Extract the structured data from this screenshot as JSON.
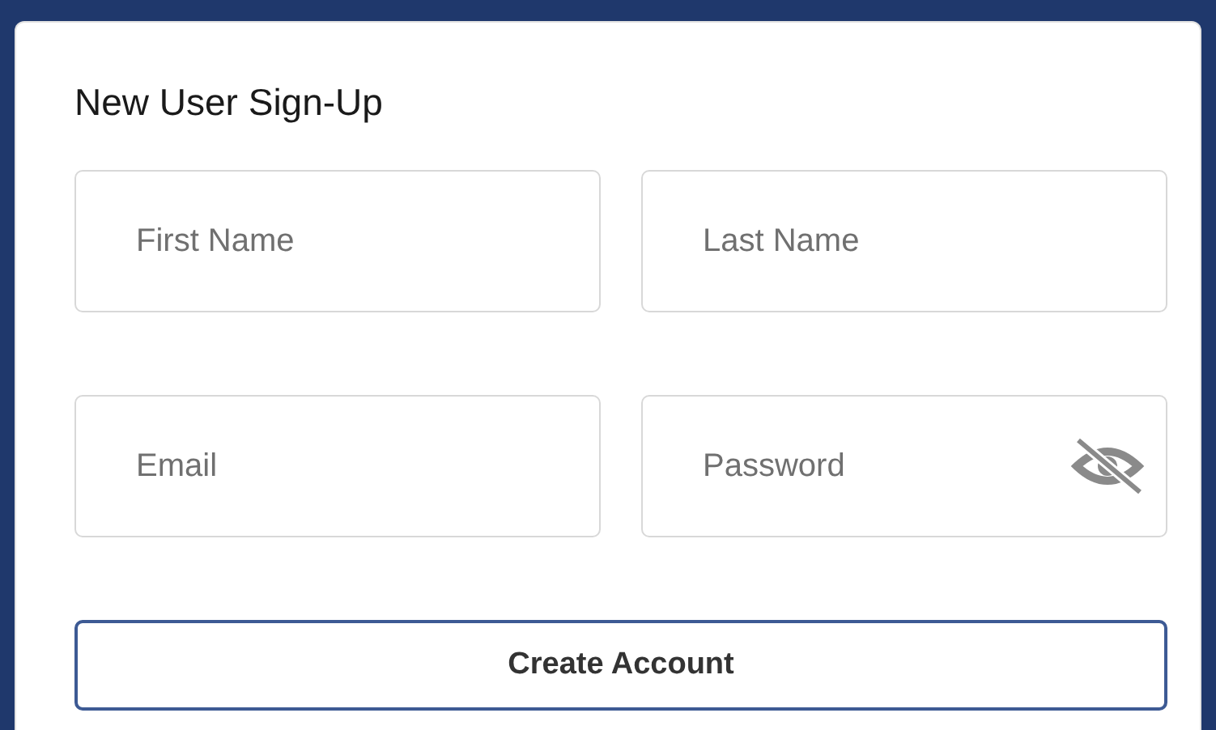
{
  "form": {
    "title": "New User Sign-Up",
    "fields": [
      {
        "placeholder": "First Name",
        "kind": "text"
      },
      {
        "placeholder": "Last Name",
        "kind": "text"
      },
      {
        "placeholder": "Email",
        "kind": "text"
      },
      {
        "placeholder": "Password",
        "kind": "password",
        "password_visible": false
      }
    ],
    "submit_button": "Create Account"
  }
}
